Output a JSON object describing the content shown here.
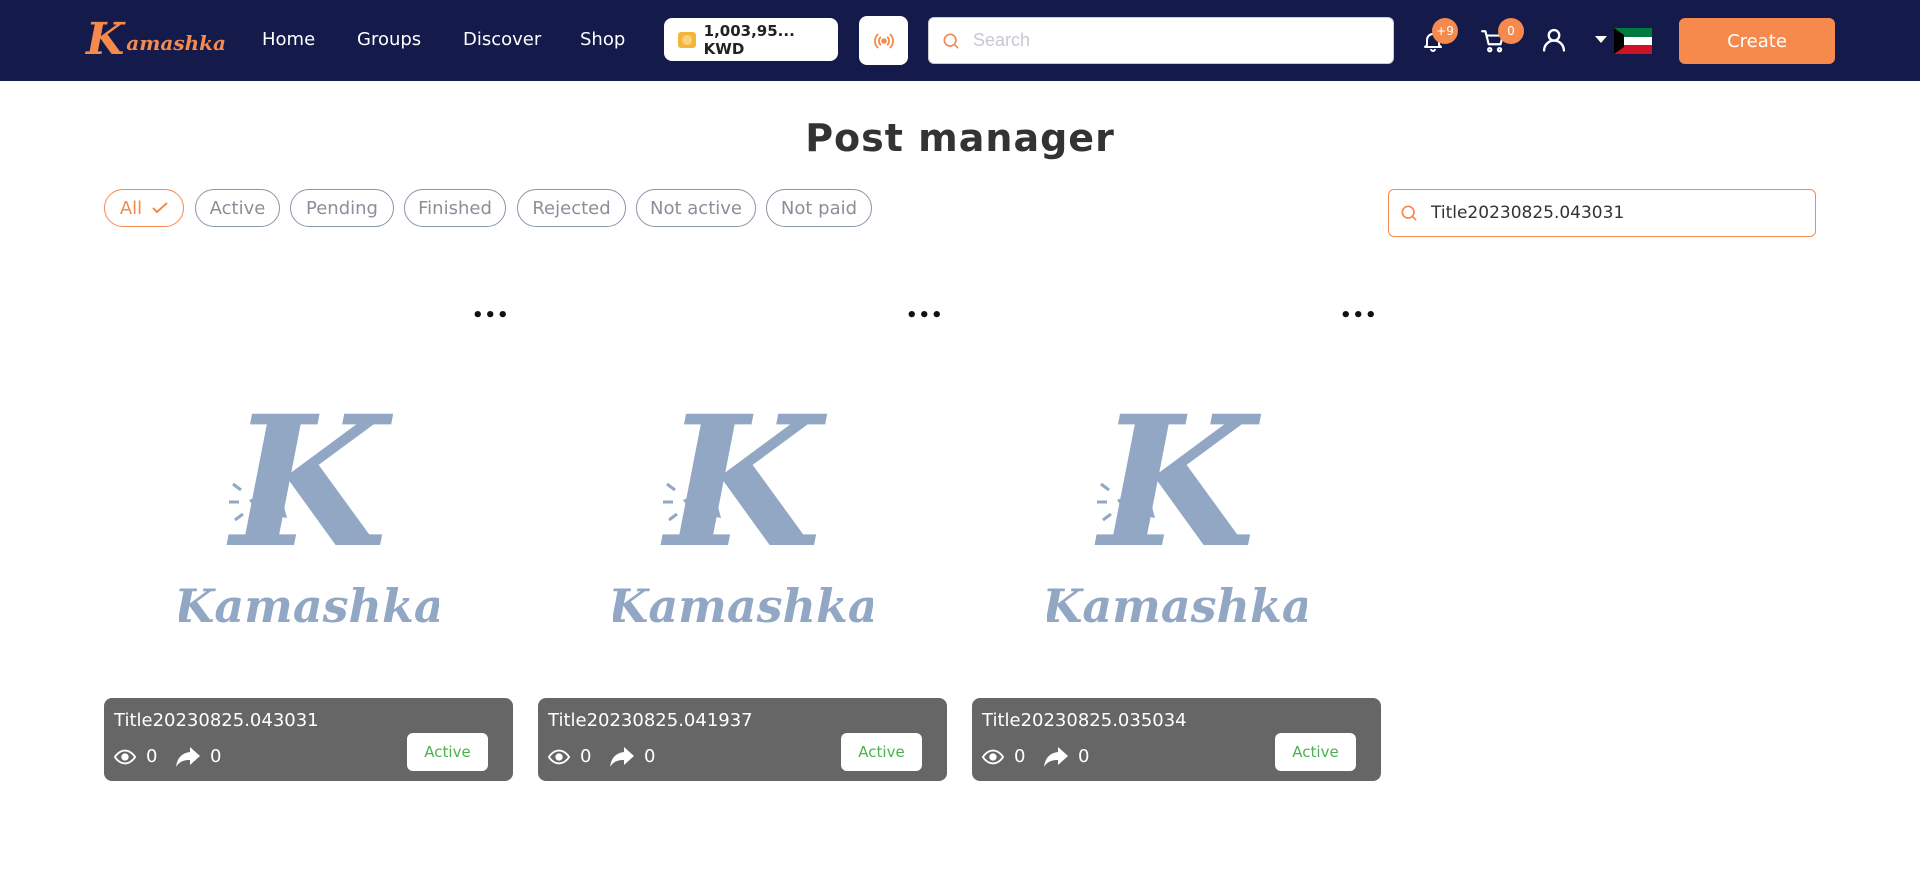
{
  "header": {
    "logo_text": "amashka",
    "logo_initial": "K",
    "nav": [
      "Home",
      "Groups",
      "Discover",
      "Shop"
    ],
    "wallet_label": "1,003,95... KWD",
    "search_placeholder": "Search",
    "notifications_badge": "+9",
    "cart_badge": "0",
    "create_label": "Create",
    "accent_color": "#f58a4c",
    "header_bg": "#141a4a"
  },
  "main": {
    "title": "Post manager",
    "filters": [
      "All",
      "Active",
      "Pending",
      "Finished",
      "Rejected",
      "Not active",
      "Not paid"
    ],
    "selected_filter": "All",
    "search_value": "Title20230825.043031"
  },
  "posts": [
    {
      "title": "Title20230825.043031",
      "views": "0",
      "shares": "0",
      "status": "Active",
      "image_text": "Kamashka"
    },
    {
      "title": "Title20230825.041937",
      "views": "0",
      "shares": "0",
      "status": "Active",
      "image_text": "Kamashka"
    },
    {
      "title": "Title20230825.035034",
      "views": "0",
      "shares": "0",
      "status": "Active",
      "image_text": "Kamashka"
    }
  ],
  "icons": {
    "wallet": "coins-icon",
    "live": "broadcast-icon",
    "search": "search-icon",
    "bell": "bell-icon",
    "cart": "cart-icon",
    "user": "user-icon",
    "flag": "kuwait-flag-icon",
    "views": "eye-icon",
    "shares": "share-icon",
    "more": "more-icon"
  }
}
